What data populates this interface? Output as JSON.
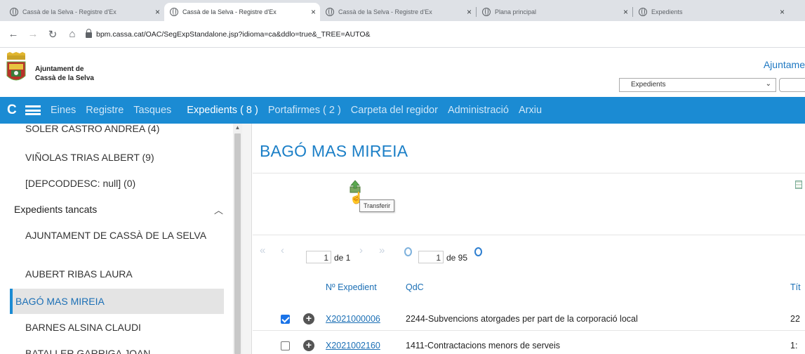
{
  "browser": {
    "tabs": [
      {
        "title": "Cassà de la Selva - Registre d'Ex",
        "active": false
      },
      {
        "title": "Cassà de la Selva - Registre d'Ex",
        "active": true
      },
      {
        "title": "Cassà de la Selva - Registre d'Ex",
        "active": false
      },
      {
        "title": "Plana principal",
        "active": false
      },
      {
        "title": "Expedients",
        "active": false
      }
    ],
    "url": "bpm.cassa.cat/OAC/SegExpStandalone.jsp?idioma=ca&ddlo=true&_TREE=AUTO&"
  },
  "header": {
    "org_line1": "Ajuntament de",
    "org_line2": "Cassà de la Selva",
    "right_title": "Ajuntame",
    "select_value": "Expedients"
  },
  "menu": {
    "items": [
      "Eines",
      "Registre",
      "Tasques",
      "Expedients ( 8 )",
      "Portafirmes ( 2 )",
      "Carpeta del regidor",
      "Administració",
      "Arxiu"
    ],
    "active_index": 3
  },
  "sidebar": {
    "items": [
      "SOLER CASTRO ANDREA (4)",
      "VIÑOLAS TRIAS ALBERT (9)",
      "[DEPCODDESC: null] (0)",
      "Expedients tancats",
      "AJUNTAMENT DE CASSÀ DE LA SELVA",
      "AUBERT RIBAS LAURA",
      "BAGÓ MAS MIREIA",
      "BARNES ALSINA CLAUDI",
      "BATALLER GARRIGA JOAN"
    ],
    "selected_index": 6
  },
  "content": {
    "title": "BAGÓ MAS MIREIA",
    "tooltip": "Transferir",
    "pager": {
      "page_value": "1",
      "page_of": "de 1",
      "group_value": "1",
      "group_of": "de 95"
    },
    "columns": {
      "expedient": "Nº Expedient",
      "qdc": "QdC",
      "title": "Tít"
    },
    "rows": [
      {
        "checked": true,
        "expedient": "X2021000006",
        "qdc": "2244-Subvencions atorgades per part de la corporació local",
        "trail": "22"
      },
      {
        "checked": false,
        "expedient": "X2021002160",
        "qdc": "1411-Contractacions menors de serveis",
        "trail": "1:"
      }
    ]
  },
  "colors": {
    "menu_bg": "#1b8bd3",
    "link": "#1b6fb5",
    "title": "#1b7fc7",
    "selected_bg": "#e4e4e4"
  }
}
